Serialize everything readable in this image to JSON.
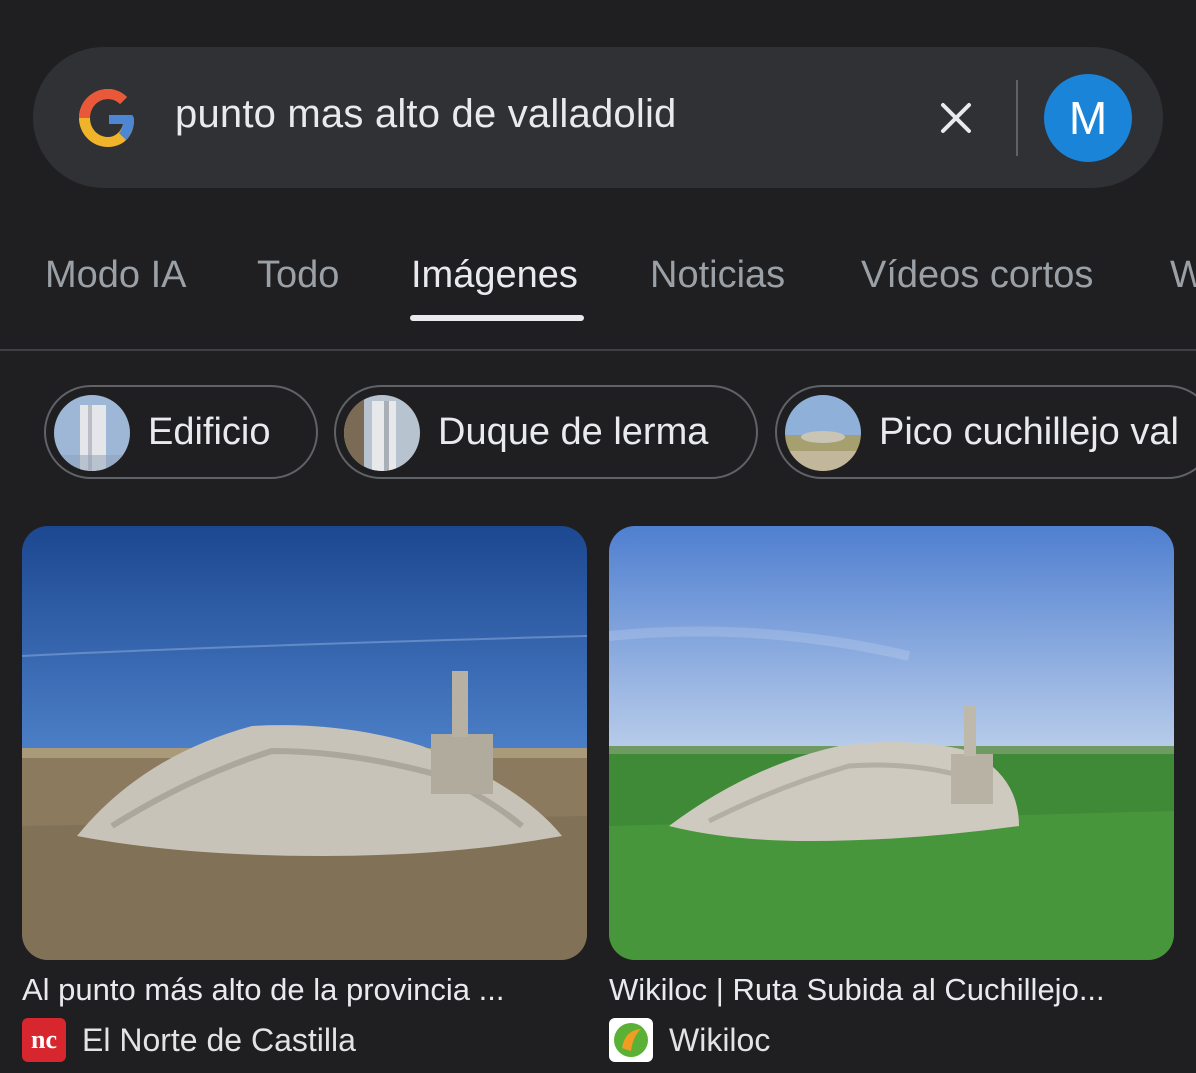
{
  "search": {
    "query": "punto mas alto de valladolid",
    "avatar_letter": "M"
  },
  "tabs": [
    {
      "label": "Modo IA"
    },
    {
      "label": "Todo"
    },
    {
      "label": "Imágenes",
      "active": true
    },
    {
      "label": "Noticias"
    },
    {
      "label": "Vídeos cortos"
    },
    {
      "label": "W"
    }
  ],
  "chips": [
    {
      "label": "Edificio"
    },
    {
      "label": "Duque de lerma"
    },
    {
      "label": "Pico cuchillejo val"
    }
  ],
  "results": [
    {
      "title": "Al punto más alto de la provincia ...",
      "source": "El Norte de Castilla",
      "source_icon_text": "nc"
    },
    {
      "title": "Wikiloc | Ruta Subida al Cuchillejo...",
      "source": "Wikiloc"
    }
  ],
  "colors": {
    "background": "#1f1f21",
    "search_bar": "#303134",
    "avatar": "#1a84d9"
  }
}
